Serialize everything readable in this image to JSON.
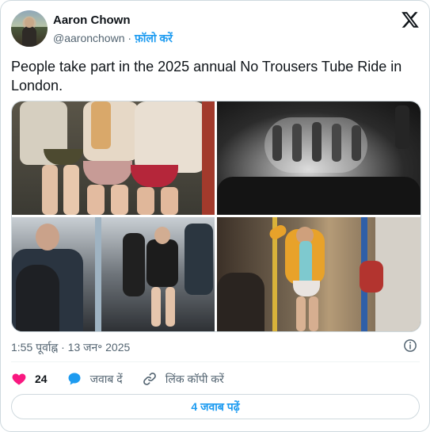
{
  "author": {
    "name": "Aaron Chown",
    "handle": "@aaronchown",
    "separator": "·",
    "follow_label": "फ़ॉलो करें"
  },
  "tweet": {
    "text": "People take part in the 2025 annual No Trousers Tube Ride in London.",
    "time": "1:55 पूर्वाह्न",
    "meta_separator": "·",
    "date": "13 जन॰ 2025"
  },
  "actions": {
    "like_count": "24",
    "reply_label": "जवाब दें",
    "copy_link_label": "लिंक कॉपी करें"
  },
  "replies_button": "4 जवाब पढ़ें",
  "colors": {
    "accent": "#1d9bf0",
    "like": "#f91880",
    "muted": "#536471",
    "border": "#cfd9de"
  },
  "icons": {
    "brand": "x-logo-icon",
    "info": "info-icon",
    "like": "heart-icon",
    "reply": "speech-bubble-icon",
    "copy": "link-icon"
  }
}
